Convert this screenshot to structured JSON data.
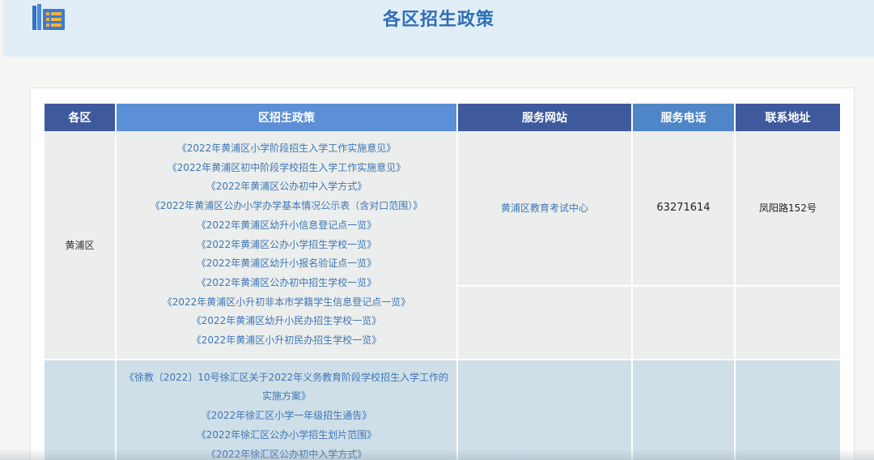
{
  "header": {
    "title": "各区招生政策",
    "logo_icon": "book-stack-icon",
    "bg_color": "#e1eef8",
    "title_color": "#2d6fb4"
  },
  "table": {
    "headers": [
      "各区",
      "区招生政策",
      "服务网站",
      "服务电话",
      "联系地址"
    ],
    "rows": [
      {
        "district": "黄浦区",
        "policies": [
          "《2022年黄浦区小学阶段招生入学工作实施意见》",
          "《2022年黄浦区初中阶段学校招生入学工作实施意见》",
          "《2022年黄浦区公办初中入学方式》",
          "《2022年黄浦区公办小学办学基本情况公示表（含对口范围）》",
          "《2022年黄浦区幼升小信息登记点一览》",
          "《2022年黄浦区公办小学招生学校一览》",
          "《2022年黄浦区幼升小报名验证点一览》",
          "《2022年黄浦区公办初中招生学校一览》",
          "《2022年黄浦区小升初非本市学籍学生信息登记点一览》",
          "《2022年黄浦区幼升小民办招生学校一览》",
          "《2022年黄浦区小升初民办招生学校一览》"
        ],
        "site": "黄浦区教育考试中心",
        "phone": "63271614",
        "address": "凤阳路152号"
      },
      {
        "district": "",
        "policies": [
          "《徐教〔2022〕10号徐汇区关于2022年义务教育阶段学校招生入学工作的",
          "实施方案》",
          "《2022年徐汇区小学一年级招生通告》",
          "《2022年徐汇区公办小学招生划片范围》",
          "《2022年徐汇区公办初中入学方式》"
        ],
        "site": "",
        "phone": "",
        "address": ""
      }
    ]
  }
}
